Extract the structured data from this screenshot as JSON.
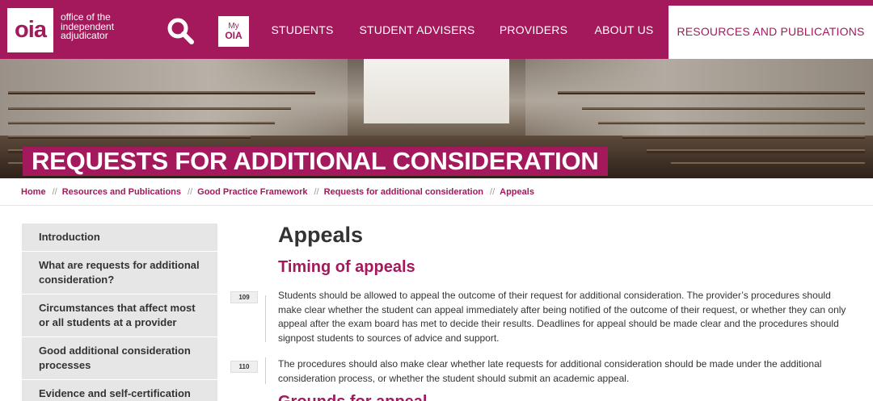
{
  "header": {
    "logo": "oia",
    "logo_lines": [
      "office of the",
      "independent",
      "adjudicator"
    ],
    "myoia_line1": "My",
    "myoia_line2": "OIA",
    "nav": [
      "STUDENTS",
      "STUDENT ADVISERS",
      "PROVIDERS",
      "ABOUT US",
      "RESOURCES AND PUBLICATIONS"
    ],
    "active_nav": "RESOURCES AND PUBLICATIONS",
    "brand_color": "#a3195b"
  },
  "hero": {
    "title": "REQUESTS FOR ADDITIONAL CONSIDERATION"
  },
  "breadcrumb": [
    "Home",
    "Resources and Publications",
    "Good Practice Framework",
    "Requests for additional consideration",
    "Appeals"
  ],
  "breadcrumb_separator": "//",
  "sidebar": {
    "items": [
      "Introduction",
      "What are requests for additional consideration?",
      "Circumstances that affect most or all students at a provider",
      "Good additional consideration processes",
      "Evidence and self-certification"
    ]
  },
  "main": {
    "title": "Appeals",
    "subtitle": "Timing of appeals",
    "paragraphs": [
      {
        "number": "109",
        "text": "Students should be allowed to appeal the outcome of their request for additional consideration. The provider’s procedures should make clear whether the student can appeal immediately after being notified of the outcome of their request, or whether they can only appeal after the exam board has met to decide their results. Deadlines for appeal should be made clear and the procedures should signpost students to sources of advice and support."
      },
      {
        "number": "110",
        "text": "The procedures should also make clear whether late requests for additional consideration should be made under the additional consideration process, or whether the student should submit an academic appeal."
      }
    ],
    "next_heading": "Grounds for appeal"
  }
}
